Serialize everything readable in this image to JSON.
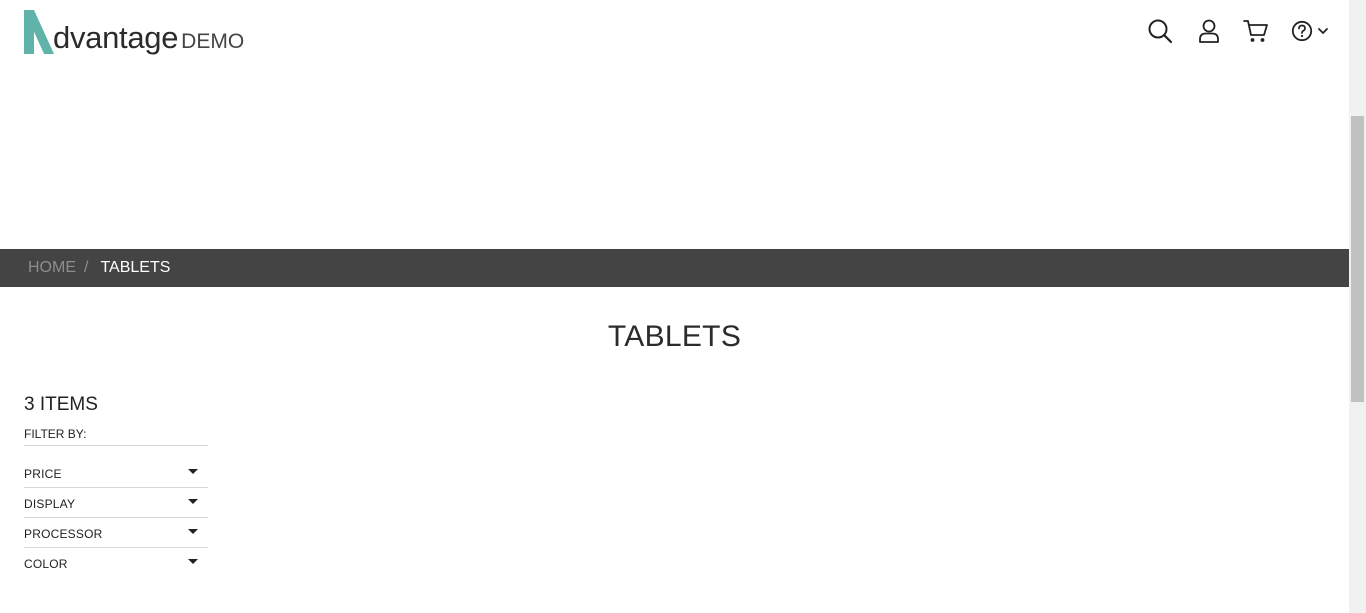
{
  "header": {
    "logo_word": "dvantage",
    "logo_suffix": "DEMO",
    "brand_color": "#5fb3a8",
    "icons": [
      "search-icon",
      "user-icon",
      "cart-icon",
      "help-icon",
      "chevron-down-icon"
    ]
  },
  "breadcrumb": {
    "home": "HOME",
    "separator": "/",
    "current": "TABLETS"
  },
  "main": {
    "title": "TABLETS",
    "items_count": "3 ITEMS",
    "filter_by": "FILTER BY:",
    "filters": [
      {
        "label": "PRICE"
      },
      {
        "label": "DISPLAY"
      },
      {
        "label": "PROCESSOR"
      },
      {
        "label": "COLOR"
      }
    ]
  },
  "colors": {
    "breadcrumb_bar": "#444444",
    "breadcrumb_inactive": "#8d8d8d",
    "breadcrumb_active": "#ffffff"
  }
}
